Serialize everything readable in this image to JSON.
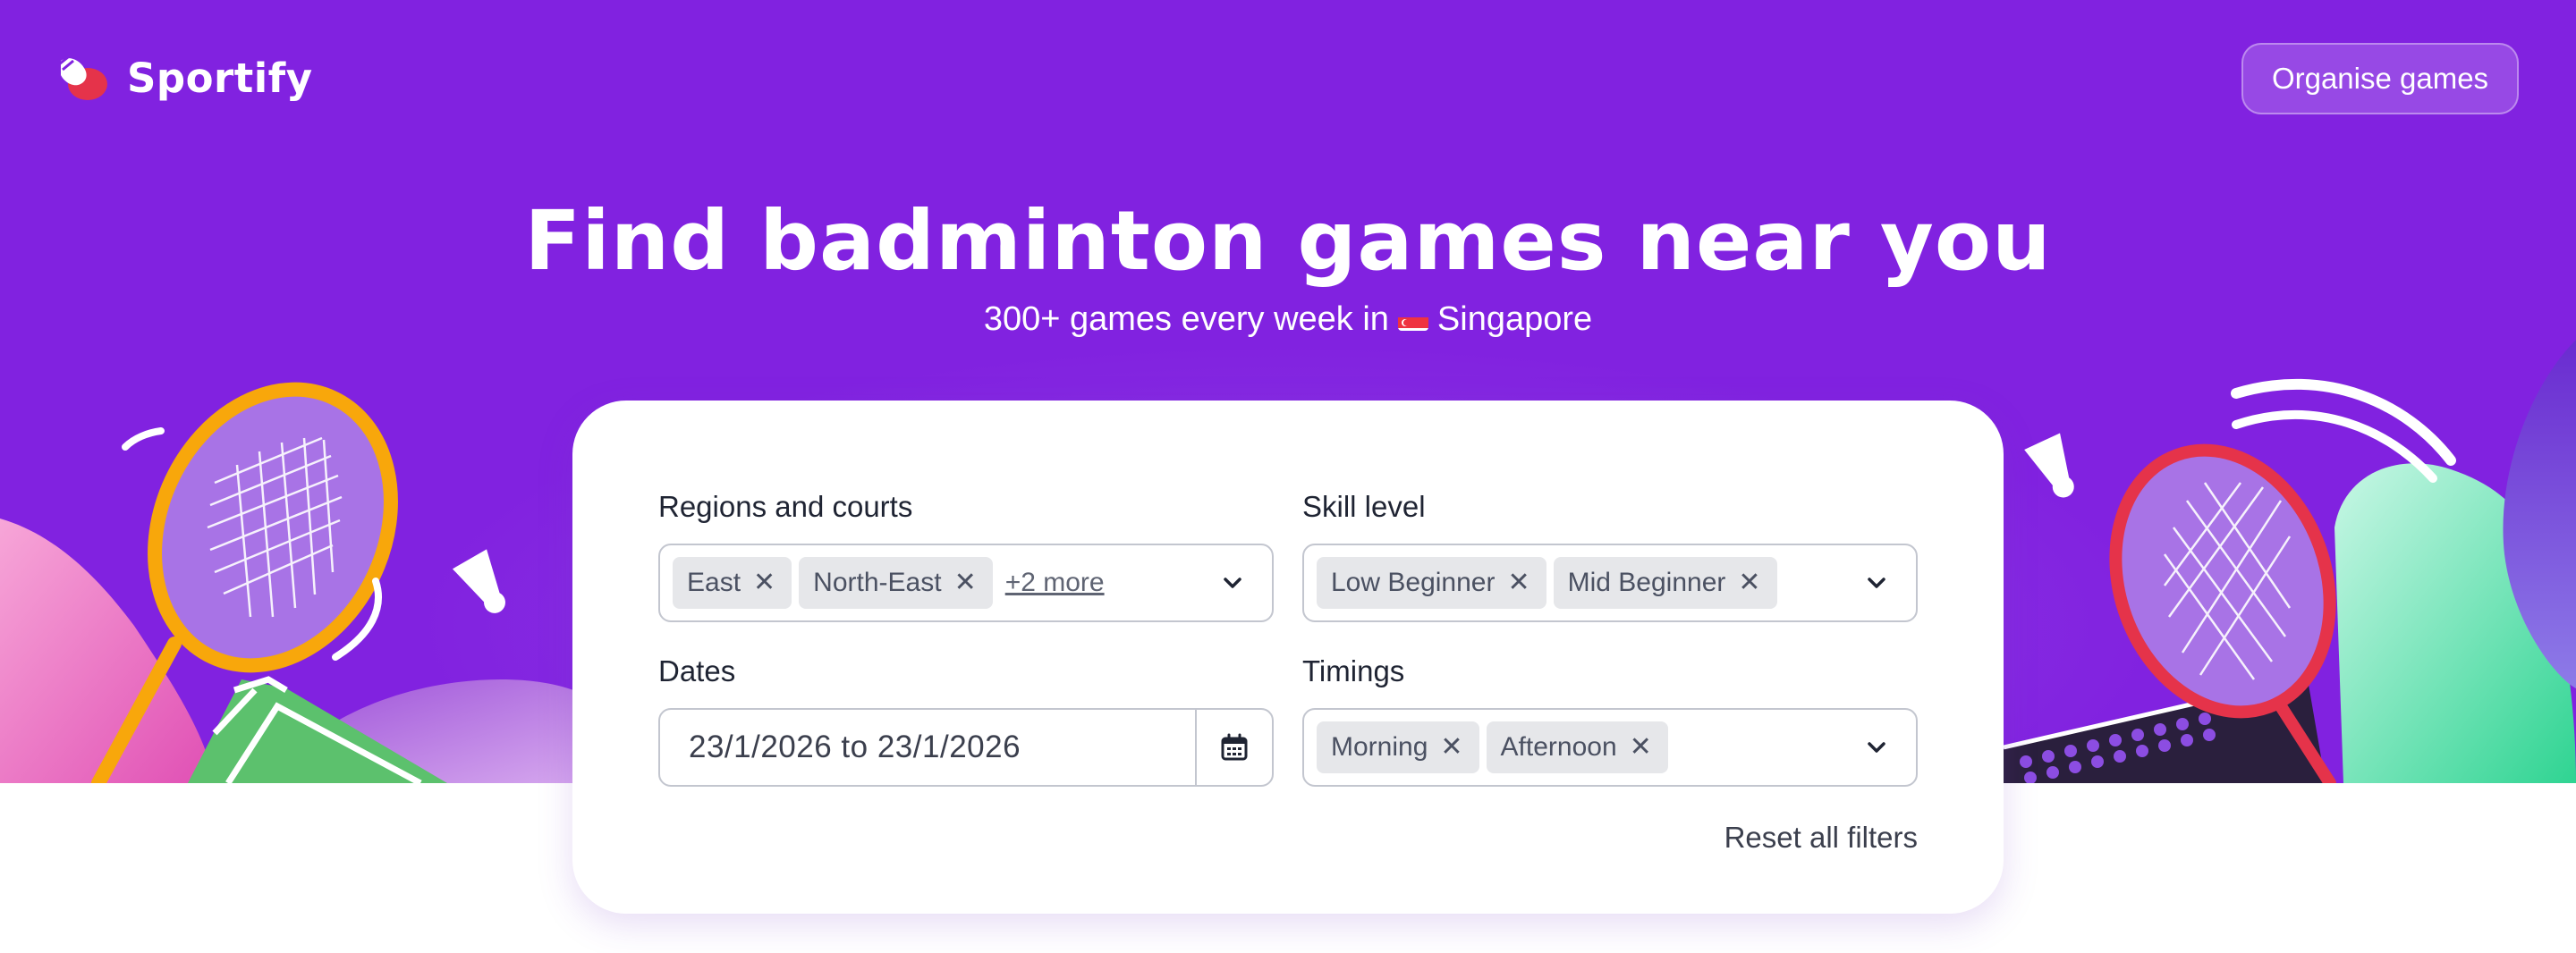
{
  "brand": {
    "name": "Sportify",
    "logo_icon": "shuttlecock-logo-icon"
  },
  "header": {
    "organise_label": "Organise games"
  },
  "hero": {
    "headline": "Find badminton games near you",
    "subline_prefix": "300+ games every week in",
    "flag_icon": "singapore-flag-icon",
    "subline_location": "Singapore"
  },
  "filters": {
    "regions": {
      "label": "Regions and courts",
      "chips": [
        "East",
        "North-East"
      ],
      "more": "+2 more"
    },
    "skill": {
      "label": "Skill level",
      "chips": [
        "Low Beginner",
        "Mid Beginner"
      ]
    },
    "dates": {
      "label": "Dates",
      "value": "23/1/2026 to 23/1/2026"
    },
    "timings": {
      "label": "Timings",
      "chips": [
        "Morning",
        "Afternoon"
      ]
    },
    "reset_label": "Reset all filters",
    "chip_remove_glyph": "✕"
  },
  "colors": {
    "hero_bg": "#8122e0",
    "racket_left": "#f8a70b",
    "racket_right": "#e5334a",
    "court_green": "#5cc16d",
    "blob_mint": "#47dca0",
    "blob_pink": "#f08ad0"
  }
}
